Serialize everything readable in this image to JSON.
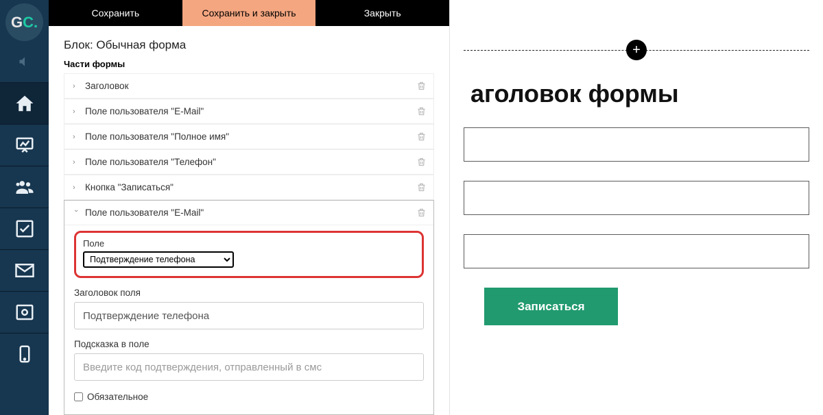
{
  "logo": {
    "g": "G",
    "c": "C."
  },
  "tabs": {
    "save": "Сохранить",
    "save_close": "Сохранить и закрыть",
    "close": "Закрыть"
  },
  "block": {
    "title": "Блок: Обычная форма",
    "parts_label": "Части формы"
  },
  "parts": [
    {
      "label": "Заголовок"
    },
    {
      "label": "Поле пользователя \"E-Mail\""
    },
    {
      "label": "Поле пользователя \"Полное имя\""
    },
    {
      "label": "Поле пользователя \"Телефон\""
    },
    {
      "label": "Кнопка \"Записаться\""
    }
  ],
  "expanded": {
    "header": "Поле пользователя \"E-Mail\"",
    "field_label": "Поле",
    "field_value": "Подтверждение телефона",
    "title_label": "Заголовок поля",
    "title_value": "Подтверждение телефона",
    "hint_label": "Подсказка в поле",
    "hint_placeholder": "Введите код подтверждения, отправленный в смс",
    "required_label": "Обязательное"
  },
  "preview": {
    "title": "аголовок формы",
    "button": "Записаться"
  }
}
